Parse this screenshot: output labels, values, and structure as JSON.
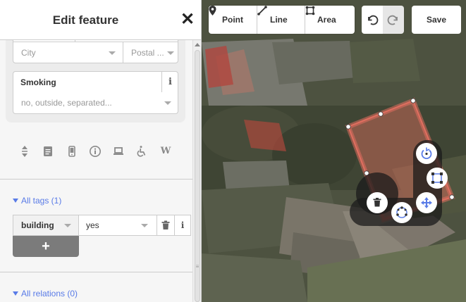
{
  "sidebar": {
    "title": "Edit feature",
    "close_icon": "close-icon",
    "fields": {
      "city_placeholder": "City",
      "postal_placeholder": "Postal ...",
      "smoking_label": "Smoking",
      "smoking_placeholder": "no, outside, separated..."
    },
    "field_icons": [
      "level-icon",
      "document-icon",
      "phone-icon",
      "info-icon",
      "laptop-icon",
      "wheelchair-icon",
      "wikipedia-icon"
    ],
    "tags_section": {
      "header": "All tags (1)",
      "tags": [
        {
          "key": "building",
          "value": "yes"
        }
      ],
      "add_label": "+"
    },
    "relations_section": {
      "header": "All relations (0)"
    }
  },
  "toolbar": {
    "point_label": "Point",
    "line_label": "Line",
    "area_label": "Area",
    "save_label": "Save"
  },
  "colors": {
    "accent": "#597be7",
    "area_stroke": "#e06e5f",
    "area_fill": "#e06e5f"
  }
}
